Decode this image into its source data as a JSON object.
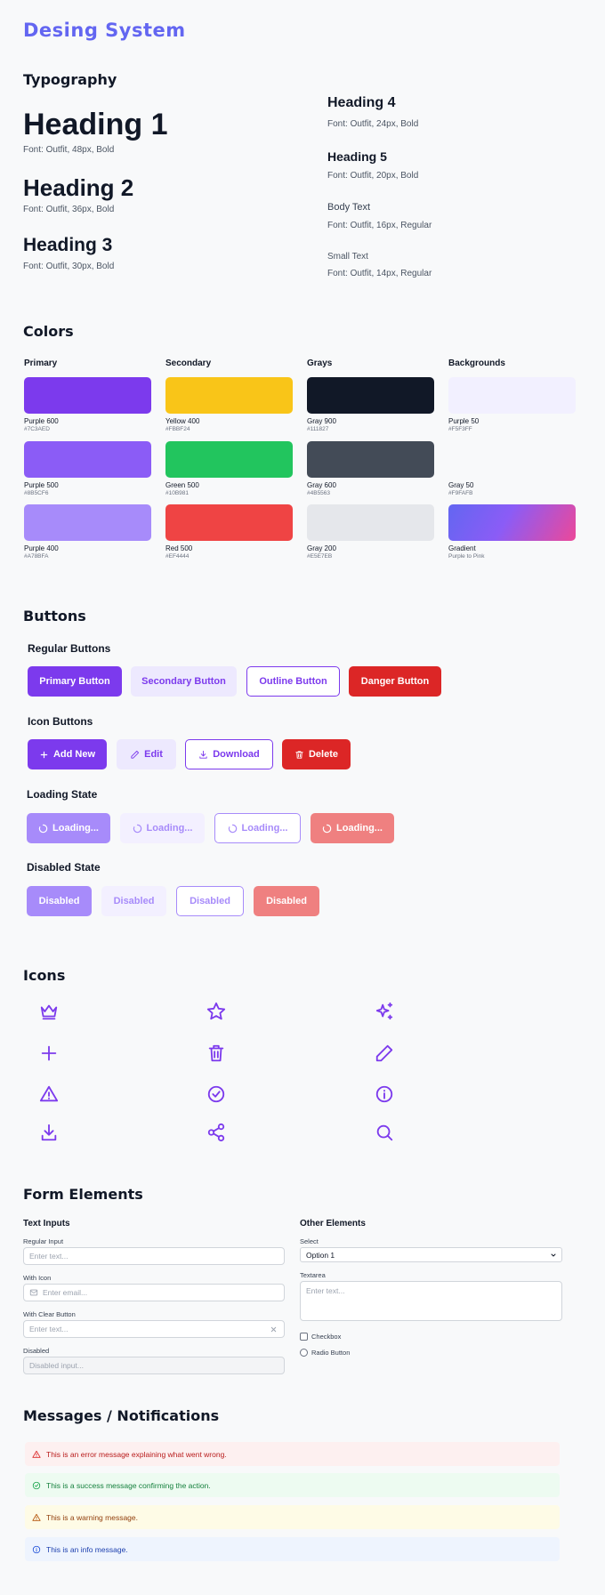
{
  "app": {
    "logo": "Desing System"
  },
  "typography": {
    "title": "Typography",
    "h1": {
      "label": "Heading 1",
      "note": "Font: Outfit, 48px, Bold"
    },
    "h2": {
      "label": "Heading 2",
      "note": "Font: Outfit, 36px, Bold"
    },
    "h3": {
      "label": "Heading 3",
      "note": "Font: Outfit, 30px, Bold"
    },
    "h4": {
      "label": "Heading 4",
      "note": "Font: Outfit, 24px, Bold"
    },
    "h5": {
      "label": "Heading 5",
      "note": "Font: Outfit, 20px, Bold"
    },
    "body": {
      "label": "Body Text",
      "note": "Font: Outfit, 16px, Regular"
    },
    "small": {
      "label": "Small Text",
      "note": "Font: Outfit, 14px, Regular"
    }
  },
  "colors": {
    "title": "Colors",
    "groups": [
      {
        "title": "Primary",
        "swatches": [
          {
            "name": "Purple 600",
            "hex": "#7C3AED",
            "color": "#7C3AED"
          },
          {
            "name": "Purple 500",
            "hex": "#8B5CF6",
            "color": "#8B5CF6"
          },
          {
            "name": "Purple 400",
            "hex": "#A78BFA",
            "color": "#A78BFA"
          }
        ]
      },
      {
        "title": "Secondary",
        "swatches": [
          {
            "name": "Yellow 400",
            "hex": "#FBBF24",
            "color": "#F9C518"
          },
          {
            "name": "Green 500",
            "hex": "#10B981",
            "color": "#22C55E"
          },
          {
            "name": "Red 500",
            "hex": "#EF4444",
            "color": "#EF4444"
          }
        ]
      },
      {
        "title": "Grays",
        "swatches": [
          {
            "name": "Gray 900",
            "hex": "#111827",
            "color": "#111827"
          },
          {
            "name": "Gray 600",
            "hex": "#4B5563",
            "color": "#434B57"
          },
          {
            "name": "Gray 200",
            "hex": "#E5E7EB",
            "color": "#E5E7EB"
          }
        ]
      },
      {
        "title": "Backgrounds",
        "swatches": [
          {
            "name": "Purple 50",
            "hex": "#F5F3FF",
            "color": "#F2F0FF"
          },
          {
            "name": "Gray 50",
            "hex": "#F9FAFB",
            "color": "#F9FAFB"
          },
          {
            "name": "Gradient",
            "hex": "Purple to Pink",
            "color": "gradient"
          }
        ]
      }
    ]
  },
  "buttons": {
    "title": "Buttons",
    "regular": {
      "title": "Regular Buttons",
      "primary": "Primary Button",
      "secondary": "Secondary Button",
      "outline": "Outline Button",
      "danger": "Danger Button"
    },
    "icon": {
      "title": "Icon Buttons",
      "add": "Add New",
      "edit": "Edit",
      "download": "Download",
      "delete": "Delete"
    },
    "loading": {
      "title": "Loading State",
      "label": "Loading..."
    },
    "disabled": {
      "title": "Disabled State",
      "label": "Disabled"
    }
  },
  "icons": {
    "title": "Icons",
    "items": [
      "crown-icon",
      "star-icon",
      "sparkles-icon",
      "plus-icon",
      "trash-icon",
      "pencil-icon",
      "warning-icon",
      "check-circle-icon",
      "info-icon",
      "download-icon",
      "share-icon",
      "search-icon"
    ]
  },
  "forms": {
    "title": "Form Elements",
    "text_inputs": {
      "title": "Text Inputs",
      "regular": {
        "label": "Regular Input",
        "placeholder": "Enter text..."
      },
      "with_icon": {
        "label": "With Icon",
        "placeholder": "Enter email..."
      },
      "clear": {
        "label": "With Clear Button",
        "placeholder": "Enter text..."
      },
      "disabled": {
        "label": "Disabled",
        "placeholder": "Disabled input..."
      }
    },
    "other": {
      "title": "Other Elements",
      "select": {
        "label": "Select",
        "value": "Option 1"
      },
      "textarea": {
        "label": "Textarea",
        "placeholder": "Enter text..."
      },
      "checkbox": "Checkbox",
      "radio": "Radio Button"
    }
  },
  "messages": {
    "title": "Messages / Notifications",
    "error": "This is an error message explaining what went wrong.",
    "success": "This is a success message confirming the action.",
    "warning": "This is a warning message.",
    "info": "This is an info message."
  }
}
